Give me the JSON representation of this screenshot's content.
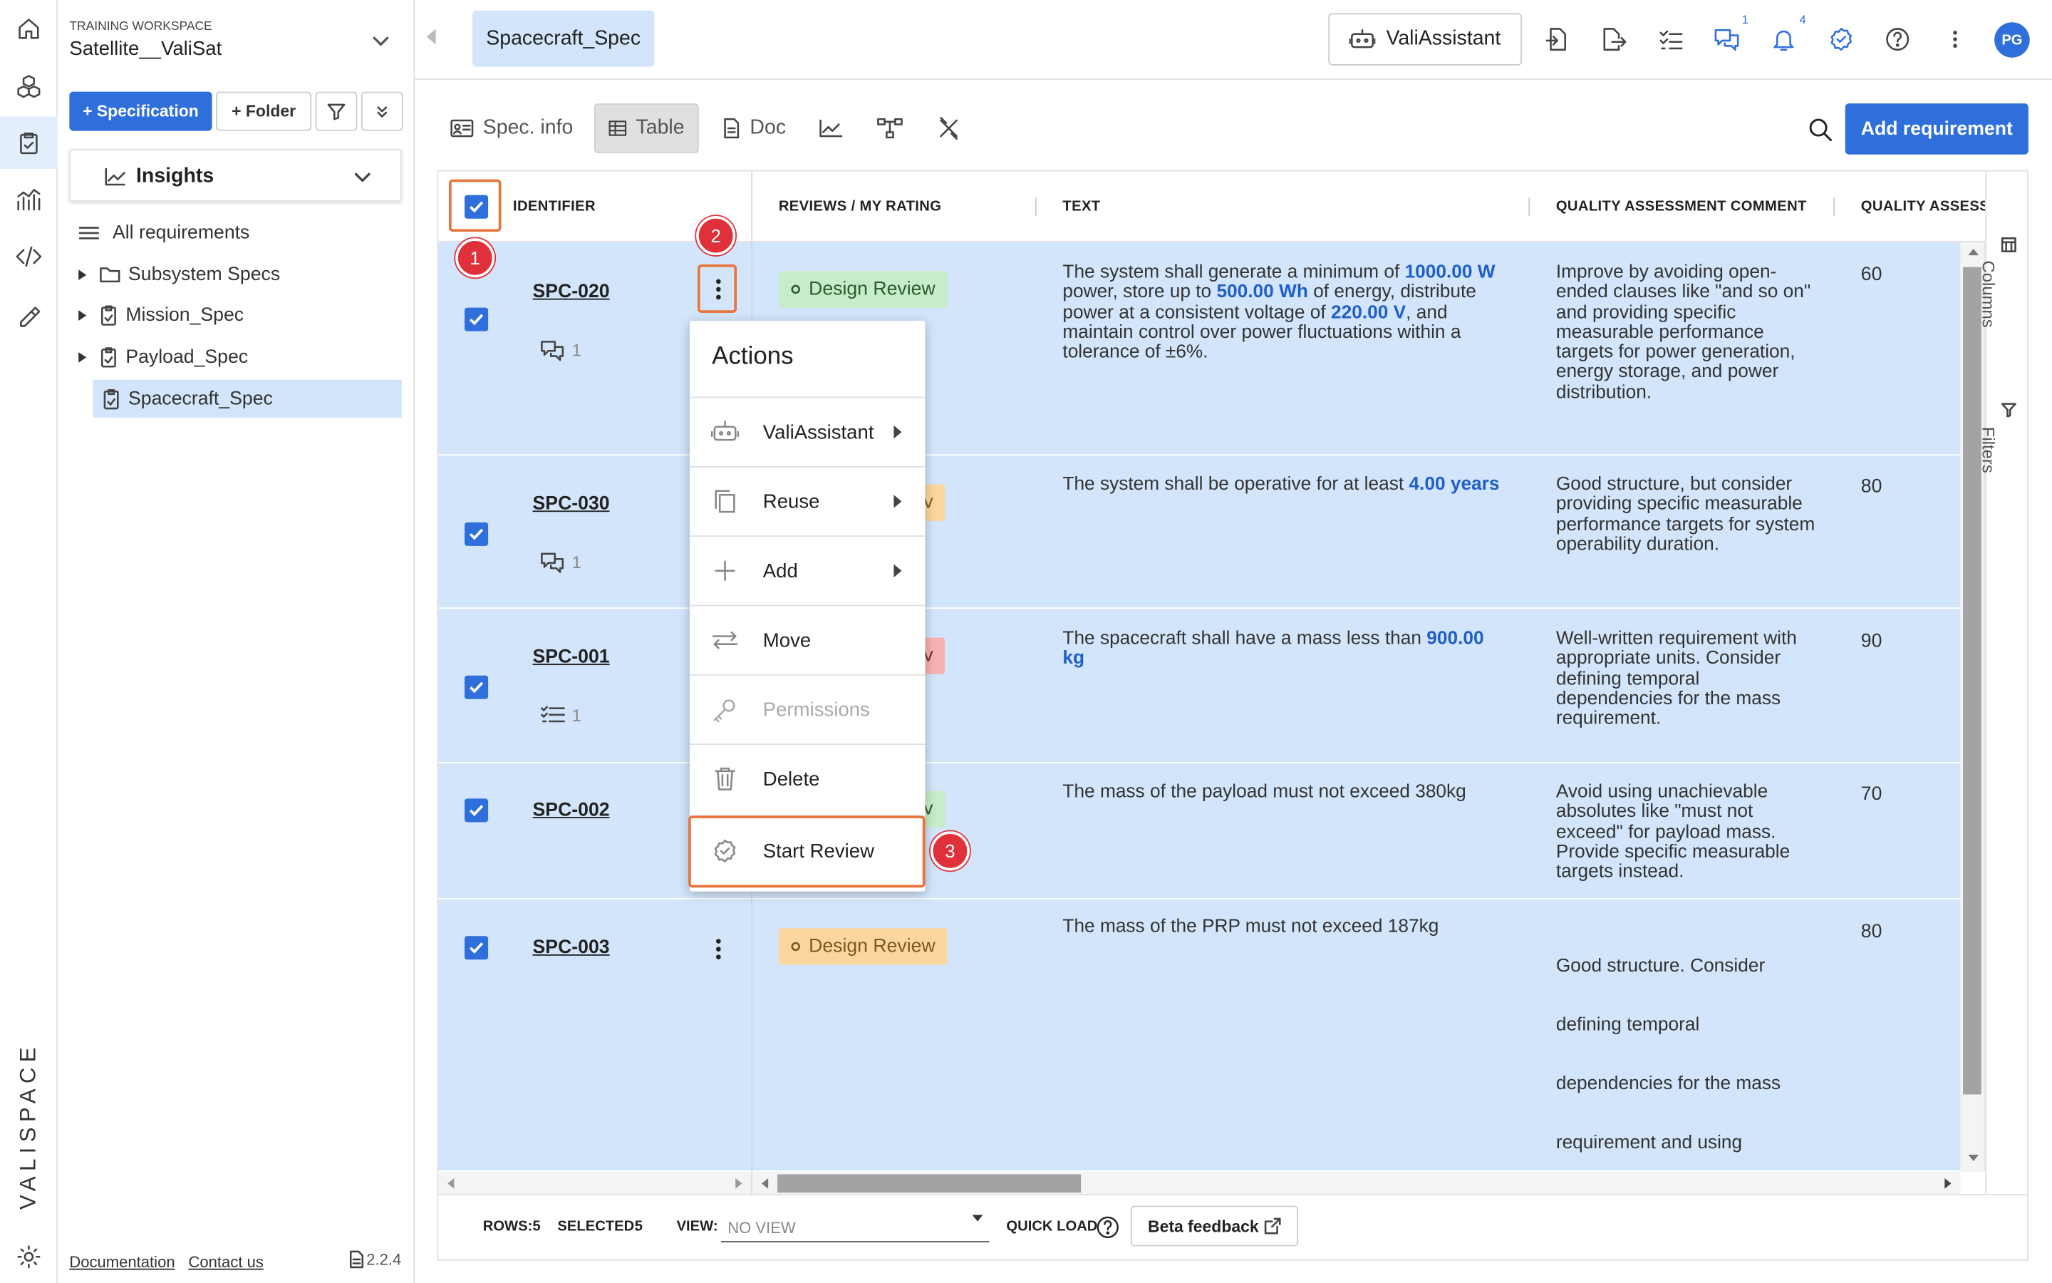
{
  "sidebar": {
    "workspace_label": "TRAINING WORKSPACE",
    "workspace_name": "Satellite__ValiSat",
    "btn_specification": "+ Specification",
    "btn_folder": "+ Folder",
    "insights_label": "Insights",
    "tree": [
      {
        "label": "All requirements"
      },
      {
        "label": "Subsystem Specs"
      },
      {
        "label": "Mission_Spec"
      },
      {
        "label": "Payload_Spec"
      },
      {
        "label": "Spacecraft_Spec"
      }
    ],
    "footer_doc": "Documentation",
    "footer_contact": "Contact us",
    "version": "2.2.4",
    "logo": "VALISPACE"
  },
  "topbar": {
    "active_tab": "Spacecraft_Spec",
    "vali_assistant": "ValiAssistant",
    "chat_count": "1",
    "notif_count": "4",
    "avatar": "PG"
  },
  "toolbar": {
    "spec_info": "Spec. info",
    "table": "Table",
    "doc": "Doc",
    "add_requirement": "Add requirement"
  },
  "table": {
    "headers": {
      "identifier": "IDENTIFIER",
      "reviews": "REVIEWS / MY RATING",
      "text": "TEXT",
      "comment": "QUALITY ASSESSMENT COMMENT",
      "quality": "QUALITY ASSESSM"
    },
    "side_columns": "Columns",
    "side_filters": "Filters",
    "rows": [
      {
        "id": "SPC-020",
        "badge": "Design Review",
        "meta_count": "1",
        "text_segments": [
          "The system shall generate a minimum of ",
          "1000.00  W",
          " power, store up to ",
          "500.00  Wh",
          " of energy, distribute power at a consistent voltage of ",
          "220.00  V",
          ", and maintain control over power fluctuations within a tolerance of ±6%."
        ],
        "comment": "Improve by avoiding open-ended clauses like \"and so on\" and providing specific measurable performance targets for power generation, energy storage, and power distribution.",
        "quality": "60"
      },
      {
        "id": "SPC-030",
        "badge_tail": "v",
        "meta_count": "1",
        "text_segments": [
          "The system shall be operative for at least ",
          "4.00  years"
        ],
        "comment": "Good structure, but consider providing specific measurable performance targets for system operability duration.",
        "quality": "80"
      },
      {
        "id": "SPC-001",
        "badge_tail": "v",
        "meta_count": "1",
        "text_segments": [
          "The spacecraft shall have a mass less than ",
          "900.00  kg"
        ],
        "comment": "Well-written requirement with appropriate units. Consider defining temporal dependencies for the mass requirement.",
        "quality": "90"
      },
      {
        "id": "SPC-002",
        "badge_tail": "v",
        "text": "The mass of the payload must not exceed 380kg",
        "comment": "Avoid using unachievable absolutes like \"must not exceed\" for payload mass. Provide specific measurable targets instead.",
        "quality": "70"
      },
      {
        "id": "SPC-003",
        "badge": "Design Review",
        "text": "The mass of the PRP must not exceed 187kg",
        "comment_lines": [
          "Good structure. Consider",
          "defining temporal",
          "dependencies for the mass",
          "requirement and using"
        ],
        "quality": "80"
      }
    ]
  },
  "menu": {
    "title": "Actions",
    "items": [
      {
        "label": "ValiAssistant"
      },
      {
        "label": "Reuse"
      },
      {
        "label": "Add"
      },
      {
        "label": "Move"
      },
      {
        "label": "Permissions"
      },
      {
        "label": "Delete"
      },
      {
        "label": "Start Review"
      }
    ]
  },
  "annotations": {
    "step1": "1",
    "step2": "2",
    "step3": "3"
  },
  "footer": {
    "rows_label": "ROWS:",
    "rows_value": "5",
    "selected_label": "SELECTED:",
    "selected_value": "5",
    "view_label": "VIEW:",
    "view_placeholder": "NO VIEW",
    "quick_load": "QUICK LOAD",
    "beta_feedback": "Beta feedback"
  },
  "colors": {
    "accent": "#2f6fdc",
    "row_selected": "#d3e5fb",
    "badge_green": "#c7ecc9",
    "badge_orange": "#fbd79f",
    "badge_red": "#f6b3b3",
    "annotation_red": "#e0313a",
    "annotation_orange": "#e8743b"
  }
}
